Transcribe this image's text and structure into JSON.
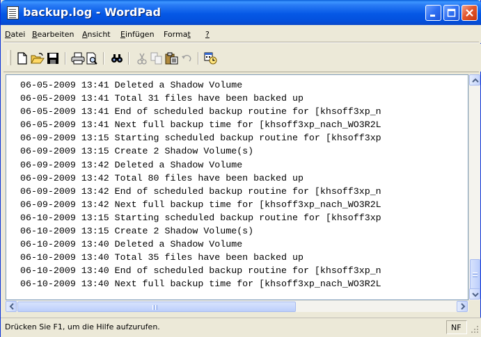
{
  "window": {
    "title": "backup.log - WordPad"
  },
  "menu": [
    {
      "label": "Datei"
    },
    {
      "label": "Bearbeiten"
    },
    {
      "label": "Ansicht"
    },
    {
      "label": "Einfügen"
    },
    {
      "label": "Format"
    },
    {
      "label": "?"
    }
  ],
  "toolbar": {
    "icons": [
      "new-document-icon",
      "open-folder-icon",
      "save-icon",
      "print-icon",
      "print-preview-icon",
      "find-icon",
      "cut-icon",
      "copy-icon",
      "paste-icon",
      "undo-icon",
      "date-time-icon"
    ]
  },
  "document": {
    "lines": [
      "06-05-2009 13:41 Deleted a Shadow Volume",
      "06-05-2009 13:41 Total 31 files have been backed up",
      "06-05-2009 13:41 End of scheduled backup routine for [khsoff3xp_n",
      "06-05-2009 13:41 Next full backup time for [khsoff3xp_nach_WO3R2L",
      "06-09-2009 13:15 Starting scheduled backup routine for [khsoff3xp",
      "06-09-2009 13:15 Create 2 Shadow Volume(s)",
      "06-09-2009 13:42 Deleted a Shadow Volume",
      "06-09-2009 13:42 Total 80 files have been backed up",
      "06-09-2009 13:42 End of scheduled backup routine for [khsoff3xp_n",
      "06-09-2009 13:42 Next full backup time for [khsoff3xp_nach_WO3R2L",
      "06-10-2009 13:15 Starting scheduled backup routine for [khsoff3xp",
      "06-10-2009 13:15 Create 2 Shadow Volume(s)",
      "06-10-2009 13:40 Deleted a Shadow Volume",
      "06-10-2009 13:40 Total 35 files have been backed up",
      "06-10-2009 13:40 End of scheduled backup routine for [khsoff3xp_n",
      "06-10-2009 13:40 Next full backup time for [khsoff3xp_nach_WO3R2L"
    ]
  },
  "status": {
    "text": "Drücken Sie F1, um die Hilfe aufzurufen.",
    "indicator": "NF"
  }
}
